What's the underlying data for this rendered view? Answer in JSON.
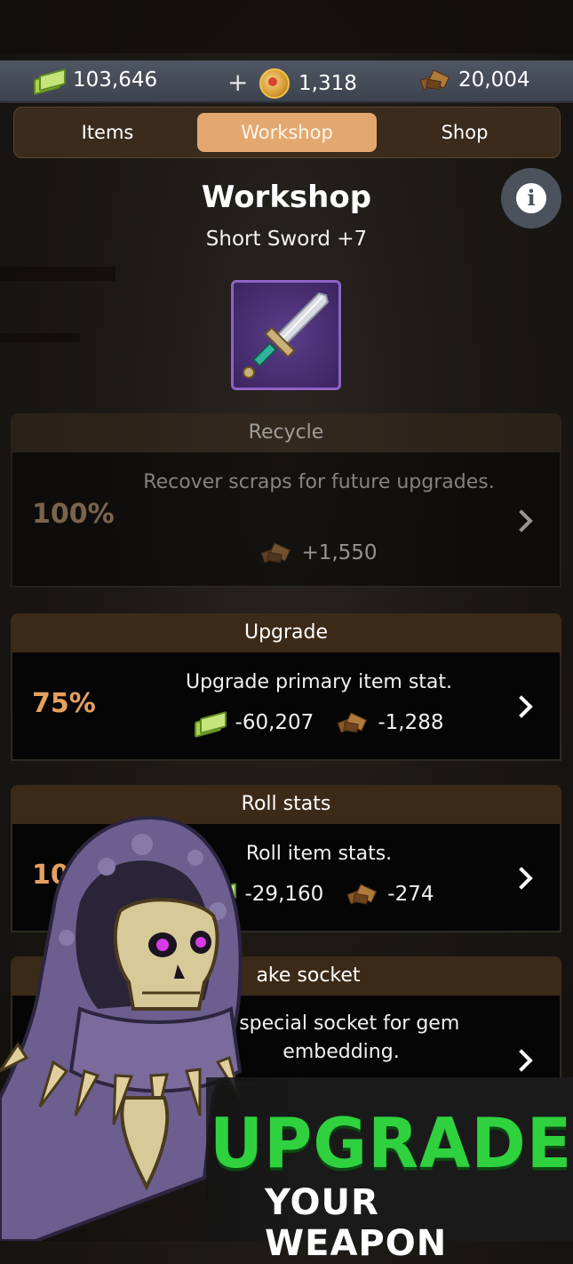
{
  "resources": {
    "cash": "103,646",
    "coins": "1,318",
    "scraps": "20,004",
    "add_label": "+"
  },
  "tabs": [
    {
      "label": "Items",
      "active": false
    },
    {
      "label": "Workshop",
      "active": true
    },
    {
      "label": "Shop",
      "active": false
    }
  ],
  "header": {
    "title": "Workshop",
    "item_name": "Short Sword +7",
    "info_icon": "info-icon"
  },
  "actions": [
    {
      "title": "Recycle",
      "chance": "100%",
      "description": "Recover scraps for future upgrades.",
      "costs": [
        {
          "icon": "scrap-icon",
          "amount": "+1,550"
        }
      ],
      "enabled": false
    },
    {
      "title": "Upgrade",
      "chance": "75%",
      "description": "Upgrade primary item stat.",
      "costs": [
        {
          "icon": "cash-icon",
          "amount": "-60,207"
        },
        {
          "icon": "scrap-icon",
          "amount": "-1,288"
        }
      ],
      "enabled": true
    },
    {
      "title": "Roll stats",
      "chance": "10",
      "description": "Roll item stats.",
      "costs": [
        {
          "icon": "cash-icon",
          "amount": "-29,160"
        },
        {
          "icon": "scrap-icon",
          "amount": "-274"
        }
      ],
      "enabled": true
    },
    {
      "title": "ake socket",
      "description": "s special socket for gem embedding.",
      "enabled": true
    }
  ],
  "promo": {
    "headline": "UPGRADE",
    "tagline": "YOUR WEAPON"
  },
  "colors": {
    "accent": "#e3a870",
    "chance": "#e6a060",
    "promo_green": "#2fd13f",
    "resource_bar": "#4f5663"
  }
}
